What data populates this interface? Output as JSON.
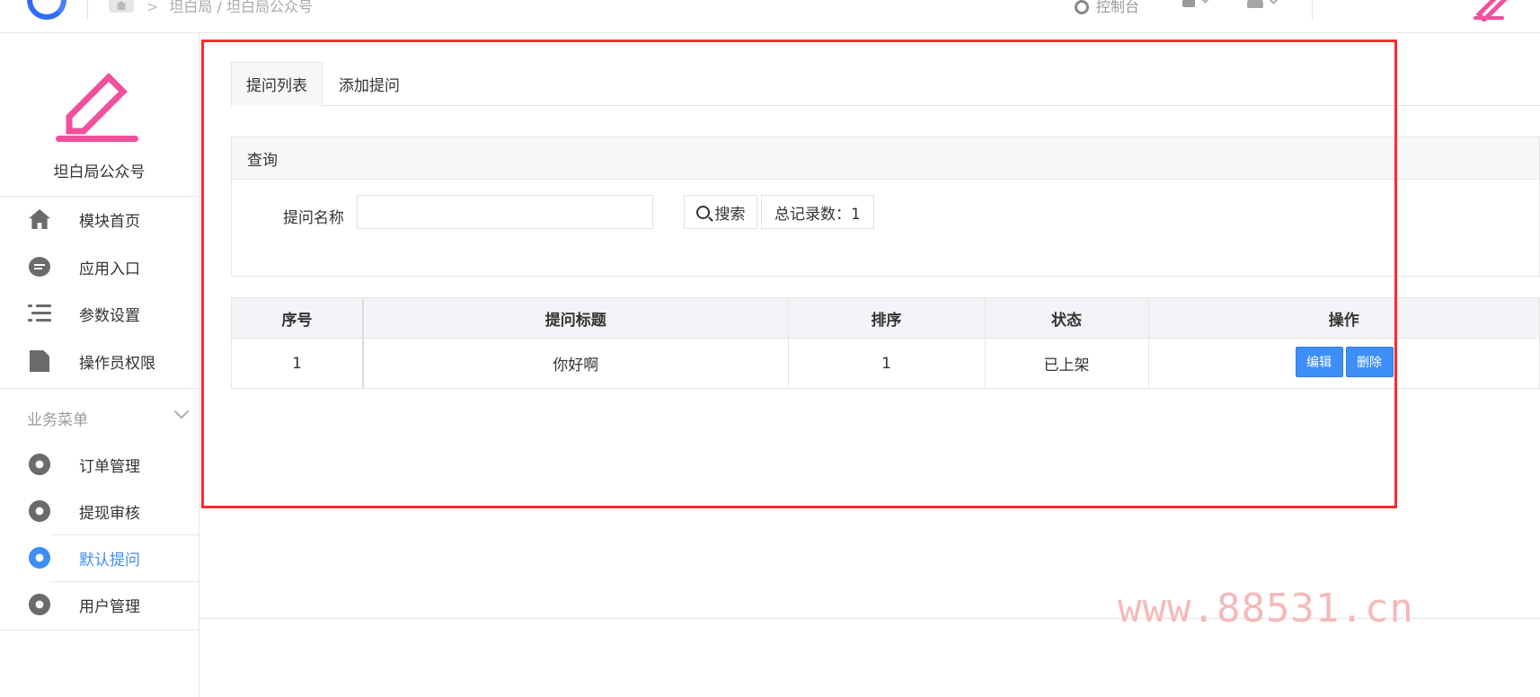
{
  "header": {
    "breadcrumb": "坦白局 / 坦白局公众号",
    "console_label": "控制台"
  },
  "sidebar": {
    "brand_name": "坦白局公众号",
    "items": [
      {
        "label": "模块首页"
      },
      {
        "label": "应用入口"
      },
      {
        "label": "参数设置"
      },
      {
        "label": "操作员权限"
      }
    ],
    "group_title": "业务菜单",
    "group_items": [
      {
        "label": "订单管理"
      },
      {
        "label": "提现审核"
      },
      {
        "label": "默认提问",
        "active": true
      },
      {
        "label": "用户管理"
      }
    ]
  },
  "tabs": [
    {
      "label": "提问列表",
      "active": true
    },
    {
      "label": "添加提问"
    }
  ],
  "query": {
    "title": "查询",
    "field_label": "提问名称",
    "field_value": "",
    "search_label": "搜索",
    "total_text": "总记录数：1"
  },
  "table": {
    "columns": [
      "序号",
      "提问标题",
      "排序",
      "状态",
      "操作"
    ],
    "rows": [
      {
        "index": "1",
        "title": "你好啊",
        "sort": "1",
        "status": "已上架",
        "edit_label": "编辑",
        "delete_label": "删除"
      }
    ]
  },
  "watermark": "www.88531.cn",
  "colors": {
    "accent": "#3d8ef7",
    "highlight": "#ff2a2a",
    "brand_pink": "#f0509c"
  }
}
